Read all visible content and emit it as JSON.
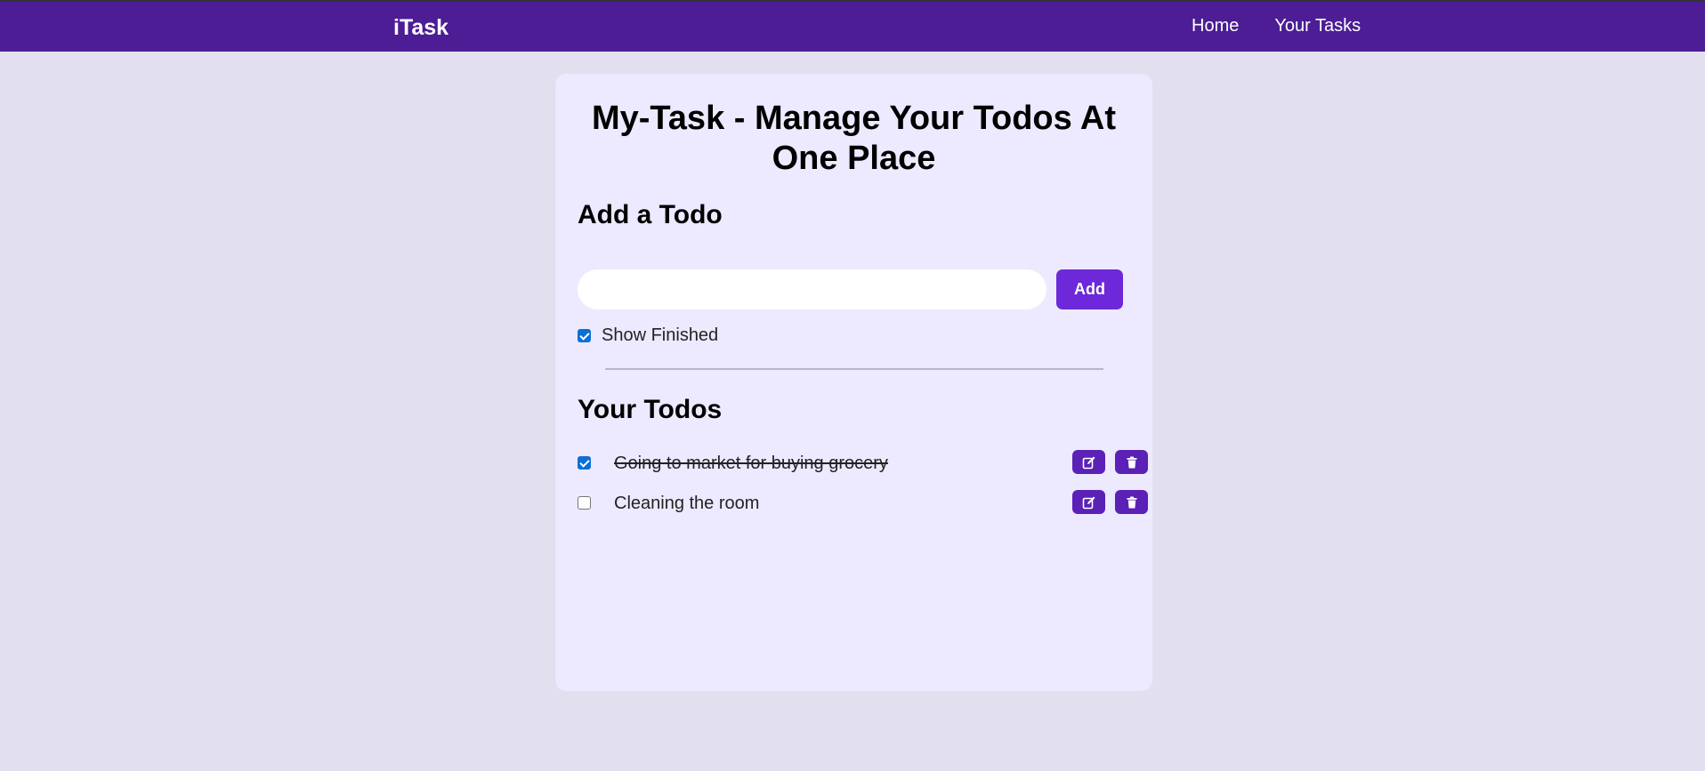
{
  "navbar": {
    "brand": "iTask",
    "links": [
      "Home",
      "Your Tasks"
    ]
  },
  "main": {
    "title": "My-Task - Manage Your Todos At One Place",
    "add_heading": "Add a Todo",
    "input_value": "",
    "add_label": "Add",
    "show_finished_label": "Show Finished",
    "show_finished_checked": true,
    "todos_heading": "Your Todos",
    "todos": [
      {
        "text": "Going to market for buying grocery",
        "completed": true
      },
      {
        "text": "Cleaning the room",
        "completed": false
      }
    ]
  },
  "colors": {
    "navbar": "#4c1d95",
    "background": "#e2dfee",
    "card": "#ede9fe",
    "accent": "#6d28d9",
    "icon_button": "#5b21b6",
    "checkbox": "#0b6fd6"
  },
  "icons": {
    "edit": "edit-icon",
    "delete": "trash-icon"
  }
}
